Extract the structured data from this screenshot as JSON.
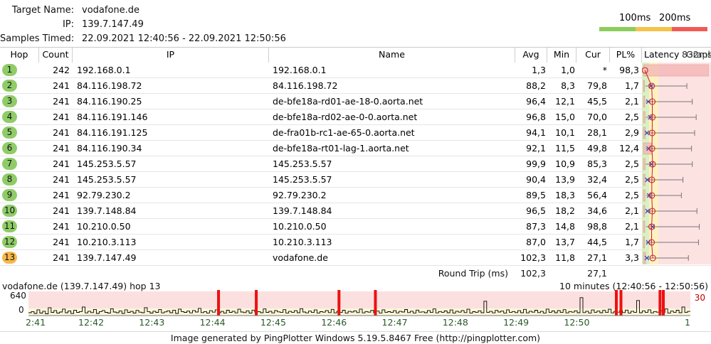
{
  "header": {
    "target_label": "Target Name:",
    "target_value": "vodafone.de",
    "ip_label": "IP:",
    "ip_value": "139.7.147.49",
    "samples_label": "Samples Timed:",
    "samples_value": "22.09.2021 12:40:56 - 22.09.2021 12:50:56",
    "scale_100": "100ms",
    "scale_200": "200ms",
    "scale_colors": {
      "green": "#8ccd5c",
      "yellow": "#f5c24b",
      "red": "#f05a52"
    }
  },
  "columns": {
    "hop": "Hop",
    "count": "Count",
    "ip": "IP",
    "name": "Name",
    "avg": "Avg",
    "min": "Min",
    "cur": "Cur",
    "pl": "PL%",
    "latency": "Latency",
    "latency_scale": "832ms",
    "graph": "Graph"
  },
  "rows": [
    {
      "hop": "1",
      "count": "242",
      "ip": "192.168.0.1",
      "name": "192.168.0.1",
      "avg": "1,3",
      "min": "1,0",
      "cur": "*",
      "pl": "98,3",
      "avg_ms": 1.3,
      "min_ms": 1.0,
      "cur_ms": 0,
      "max_ms": 1.3,
      "pl_pct": 98.3
    },
    {
      "hop": "2",
      "count": "241",
      "ip": "84.116.198.72",
      "name": "84.116.198.72",
      "avg": "88,2",
      "min": "8,3",
      "cur": "79,8",
      "pl": "1,7",
      "avg_ms": 88.2,
      "min_ms": 8.3,
      "cur_ms": 79.8,
      "max_ms": 540,
      "pl_pct": 1.7
    },
    {
      "hop": "3",
      "count": "241",
      "ip": "84.116.190.25",
      "name": "de-bfe18a-rd01-ae-18-0.aorta.net",
      "avg": "96,4",
      "min": "12,1",
      "cur": "45,5",
      "pl": "2,1",
      "avg_ms": 96.4,
      "min_ms": 12.1,
      "cur_ms": 45.5,
      "max_ms": 610,
      "pl_pct": 2.1
    },
    {
      "hop": "4",
      "count": "241",
      "ip": "84.116.191.146",
      "name": "de-bfe18a-rd02-ae-0-0.aorta.net",
      "avg": "96,8",
      "min": "15,0",
      "cur": "70,0",
      "pl": "2,5",
      "avg_ms": 96.8,
      "min_ms": 15.0,
      "cur_ms": 70.0,
      "max_ms": 660,
      "pl_pct": 2.5
    },
    {
      "hop": "5",
      "count": "241",
      "ip": "84.116.191.125",
      "name": "de-fra01b-rc1-ae-65-0.aorta.net",
      "avg": "94,1",
      "min": "10,1",
      "cur": "28,1",
      "pl": "2,9",
      "avg_ms": 94.1,
      "min_ms": 10.1,
      "cur_ms": 28.1,
      "max_ms": 640,
      "pl_pct": 2.9
    },
    {
      "hop": "6",
      "count": "241",
      "ip": "84.116.190.34",
      "name": "de-bfe18a-rt01-lag-1.aorta.net",
      "avg": "92,1",
      "min": "11,5",
      "cur": "49,8",
      "pl": "12,4",
      "avg_ms": 92.1,
      "min_ms": 11.5,
      "cur_ms": 49.8,
      "max_ms": 600,
      "pl_pct": 12.4
    },
    {
      "hop": "7",
      "count": "241",
      "ip": "145.253.5.57",
      "name": "145.253.5.57",
      "avg": "99,9",
      "min": "10,9",
      "cur": "85,3",
      "pl": "2,5",
      "avg_ms": 99.9,
      "min_ms": 10.9,
      "cur_ms": 85.3,
      "max_ms": 610,
      "pl_pct": 2.5
    },
    {
      "hop": "8",
      "count": "241",
      "ip": "145.253.5.57",
      "name": "145.253.5.57",
      "avg": "90,4",
      "min": "13,9",
      "cur": "32,4",
      "pl": "2,5",
      "avg_ms": 90.4,
      "min_ms": 13.9,
      "cur_ms": 32.4,
      "max_ms": 490,
      "pl_pct": 2.5
    },
    {
      "hop": "9",
      "count": "241",
      "ip": "92.79.230.2",
      "name": "92.79.230.2",
      "avg": "89,5",
      "min": "18,3",
      "cur": "56,4",
      "pl": "2,5",
      "avg_ms": 89.5,
      "min_ms": 18.3,
      "cur_ms": 56.4,
      "max_ms": 470,
      "pl_pct": 2.5
    },
    {
      "hop": "10",
      "count": "241",
      "ip": "139.7.148.84",
      "name": "139.7.148.84",
      "avg": "96,5",
      "min": "18,2",
      "cur": "34,6",
      "pl": "2,1",
      "avg_ms": 96.5,
      "min_ms": 18.2,
      "cur_ms": 34.6,
      "max_ms": 670,
      "pl_pct": 2.1
    },
    {
      "hop": "11",
      "count": "241",
      "ip": "10.210.0.50",
      "name": "10.210.0.50",
      "avg": "87,3",
      "min": "14,8",
      "cur": "98,8",
      "pl": "2,1",
      "avg_ms": 87.3,
      "min_ms": 14.8,
      "cur_ms": 98.8,
      "max_ms": 700,
      "pl_pct": 2.1
    },
    {
      "hop": "12",
      "count": "241",
      "ip": "10.210.3.113",
      "name": "10.210.3.113",
      "avg": "87,0",
      "min": "13,7",
      "cur": "44,5",
      "pl": "1,7",
      "avg_ms": 87.0,
      "min_ms": 13.7,
      "cur_ms": 44.5,
      "max_ms": 690,
      "pl_pct": 1.7
    },
    {
      "hop": "13",
      "count": "241",
      "ip": "139.7.147.49",
      "name": "vodafone.de",
      "avg": "102,3",
      "min": "11,8",
      "cur": "27,1",
      "pl": "3,3",
      "avg_ms": 102.3,
      "min_ms": 11.8,
      "cur_ms": 27.1,
      "max_ms": 560,
      "pl_pct": 3.3
    }
  ],
  "round_trip": {
    "label": "Round Trip (ms)",
    "avg": "102,3",
    "cur": "27,1"
  },
  "graph": {
    "title": "vodafone.de (139.7.147.49) hop 13",
    "range": "10 minutes (12:40:56 - 12:50:56)",
    "y_top": "640",
    "y_bottom": "0",
    "right_value": "30",
    "x_ticks": [
      "2:41",
      "12:42",
      "12:43",
      "12:44",
      "12:45",
      "12:46",
      "12:47",
      "12:48",
      "12:49",
      "12:50",
      "1"
    ],
    "loss_markers_pct": [
      28.5,
      34.2,
      46.7,
      52.2,
      88.6,
      89.3,
      95.2,
      95.7
    ],
    "latency_values": [
      40,
      55,
      30,
      80,
      35,
      60,
      25,
      110,
      45,
      70,
      35,
      50,
      90,
      40,
      65,
      30,
      75,
      45,
      55,
      120,
      38,
      60,
      42,
      85,
      30,
      55,
      70,
      45,
      35,
      95,
      50,
      40,
      65,
      30,
      80,
      45,
      58,
      35,
      72,
      48,
      40,
      110,
      55,
      35,
      60,
      45,
      85,
      38,
      52,
      66,
      40,
      75,
      30,
      90,
      55,
      45,
      62,
      38,
      70,
      50,
      100,
      42,
      55,
      36,
      68,
      48,
      80,
      40,
      58,
      34,
      74,
      45,
      60,
      38,
      88,
      50,
      42,
      66,
      35,
      76,
      48,
      55,
      40,
      92,
      45,
      60,
      38,
      70,
      52,
      44,
      82,
      36,
      58,
      46,
      68,
      40,
      96,
      50,
      38,
      62,
      44,
      78,
      36,
      54,
      48,
      70,
      42,
      86,
      38,
      60,
      46,
      74,
      34,
      58,
      50,
      66,
      42,
      90,
      38,
      56,
      48,
      72,
      40,
      62,
      36,
      80,
      46,
      54,
      44,
      68,
      38,
      58,
      50,
      84,
      42,
      60,
      36,
      76,
      48,
      52,
      40,
      70,
      44,
      92,
      38,
      56,
      46,
      64,
      40,
      78,
      34,
      60,
      48,
      70,
      42,
      88,
      36,
      54,
      46,
      66,
      40,
      200,
      44,
      58,
      38,
      72,
      50,
      62,
      36,
      80,
      46,
      56,
      42,
      68,
      40,
      86,
      38,
      60,
      48,
      74,
      42,
      58,
      36,
      90,
      46,
      64,
      40,
      70,
      44,
      82,
      38,
      56,
      48,
      66,
      40,
      250,
      42,
      60,
      36,
      78,
      46,
      62,
      40,
      72,
      44,
      88,
      38,
      58,
      48,
      68,
      42,
      76,
      36,
      60,
      46,
      210,
      40,
      66,
      44,
      80,
      38,
      56,
      48,
      70,
      42,
      92,
      36,
      62,
      46,
      74,
      40,
      120,
      44,
      58
    ]
  }
}
